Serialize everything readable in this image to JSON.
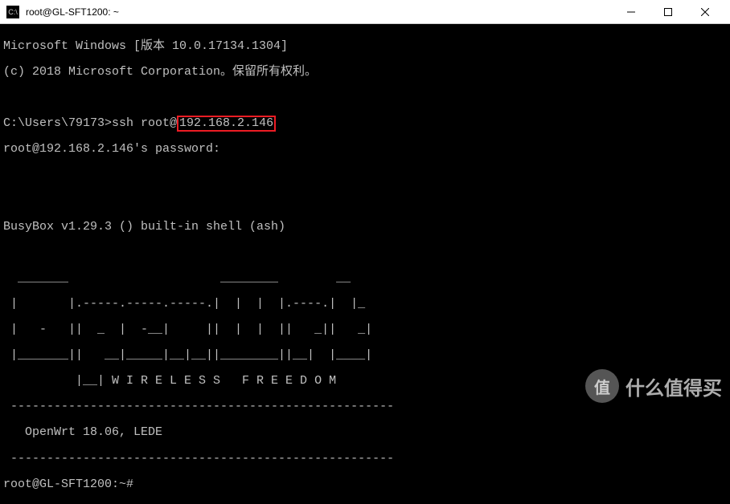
{
  "window": {
    "title": "root@GL-SFT1200: ~",
    "icon_label": "C:\\"
  },
  "terminal": {
    "line1": "Microsoft Windows [版本 10.0.17134.1304]",
    "line2": "(c) 2018 Microsoft Corporation。保留所有权利。",
    "line3_prefix": "C:\\Users\\79173>ssh root@",
    "line3_highlight": "192.168.2.146",
    "line4": "root@192.168.2.146's password:",
    "line5": "",
    "line6": "",
    "line7": "BusyBox v1.29.3 () built-in shell (ash)",
    "line8": "",
    "ascii1": "  _______                     ________        __",
    "ascii2": " |       |.-----.-----.-----.|  |  |  |.----.|  |_",
    "ascii3": " |   -   ||  _  |  -__|     ||  |  |  ||   _||   _|",
    "ascii4": " |_______||   __|_____|__|__||________||__|  |____|",
    "ascii5": "          |__| W I R E L E S S   F R E E D O M",
    "divider1": " -----------------------------------------------------",
    "version_line": "   OpenWrt 18.06, LEDE",
    "divider2": " -----------------------------------------------------",
    "prompt": "root@GL-SFT1200:~# "
  },
  "watermark": {
    "circle_text": "值",
    "text": "什么值得买"
  }
}
